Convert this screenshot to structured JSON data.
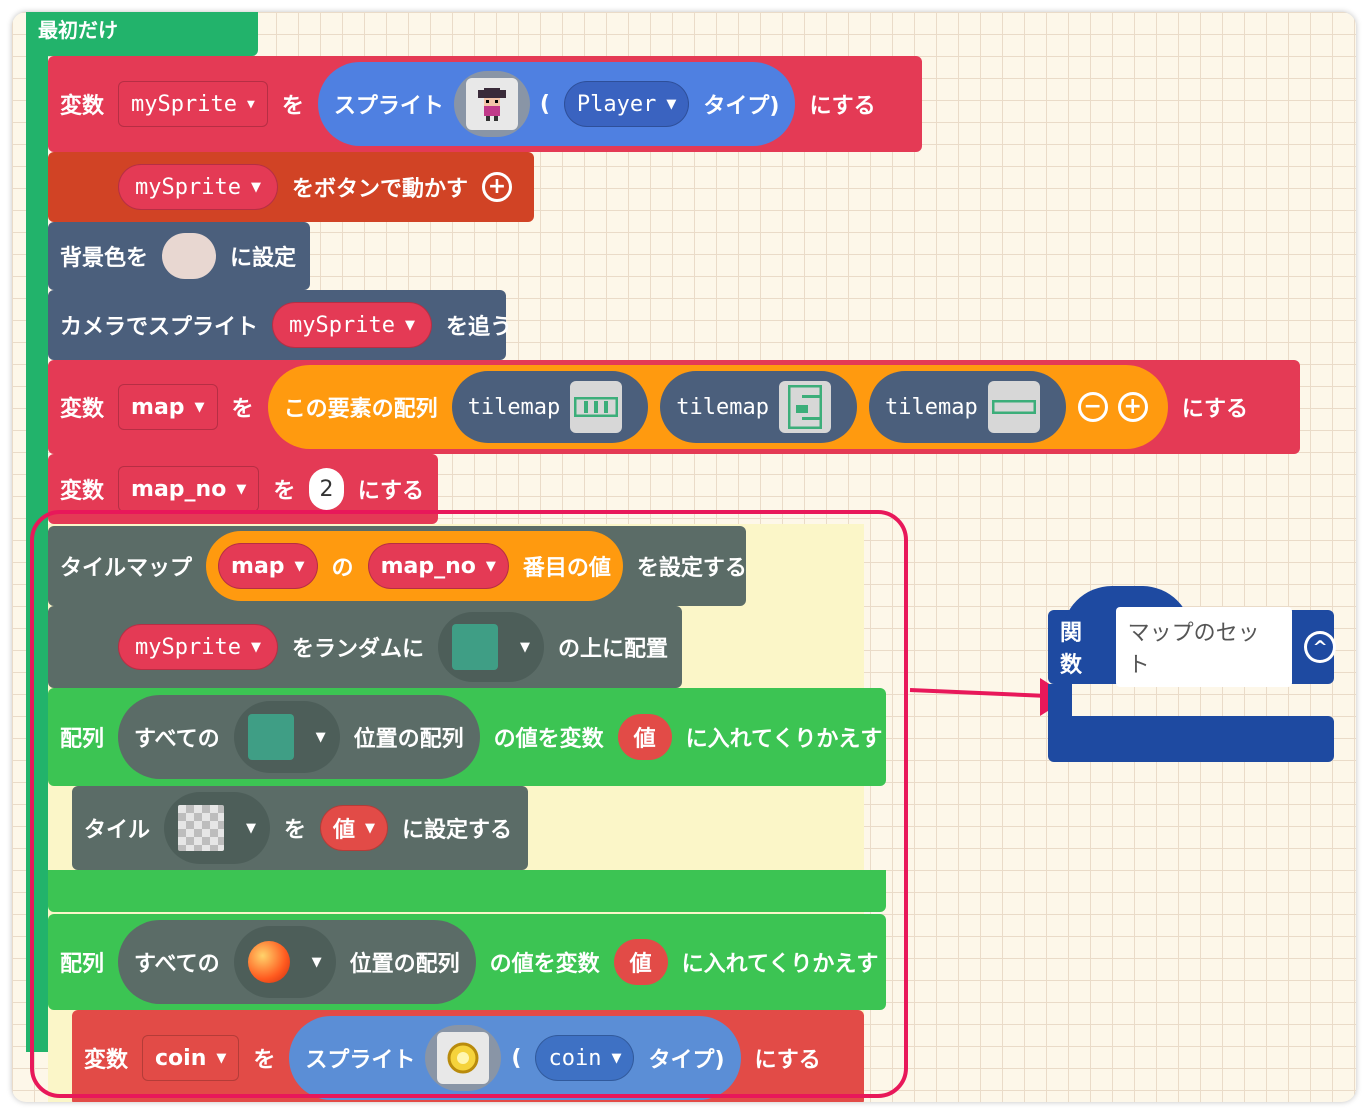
{
  "hat": {
    "label": "最初だけ"
  },
  "b1": {
    "var_word": "変数",
    "var": "mySprite",
    "wo": "を",
    "sprite": "スプライト",
    "paren_open": "(",
    "kind": "Player",
    "kind_close": "タイプ)",
    "suru": "にする"
  },
  "b2": {
    "var": "mySprite",
    "text": "をボタンで動かす"
  },
  "b3": {
    "text": "背景色を",
    "text2": "に設定",
    "color": "#e8d7d1"
  },
  "b4": {
    "text": "カメラでスプライト",
    "var": "mySprite",
    "text2": "を追う"
  },
  "b5": {
    "var_word": "変数",
    "var": "map",
    "wo": "を",
    "arr": "この要素の配列",
    "items": [
      "tilemap",
      "tilemap",
      "tilemap"
    ],
    "suru": "にする"
  },
  "b6": {
    "var_word": "変数",
    "var": "map_no",
    "wo": "を",
    "value": "2",
    "suru": "にする"
  },
  "b7": {
    "text": "タイルマップ",
    "arr": "map",
    "no": "の",
    "idx": "map_no",
    "nth": "番目の値",
    "set": "を設定する"
  },
  "b8": {
    "var": "mySprite",
    "text": "をランダムに",
    "text2": "の上に配置"
  },
  "b9": {
    "label": "配列",
    "all": "すべての",
    "pos": "位置の配列",
    "val_text": "の値を変数",
    "val": "値",
    "loop": "に入れてくりかえす"
  },
  "b10": {
    "label": "タイル",
    "wo": "を",
    "val": "値",
    "set": "に設定する"
  },
  "b11": {
    "label": "配列",
    "all": "すべての",
    "pos": "位置の配列",
    "val_text": "の値を変数",
    "val": "値",
    "loop": "に入れてくりかえす"
  },
  "b12": {
    "var_word": "変数",
    "var": "coin",
    "wo": "を",
    "sprite": "スプライト",
    "paren_open": "(",
    "kind": "coin",
    "kind_close": "タイプ)",
    "suru": "にする"
  },
  "func": {
    "label": "関数",
    "name": "マップのセット"
  },
  "colors": {
    "highlight": "#e8185a",
    "hat": "#22b36b",
    "func": "#1e4aa1"
  }
}
